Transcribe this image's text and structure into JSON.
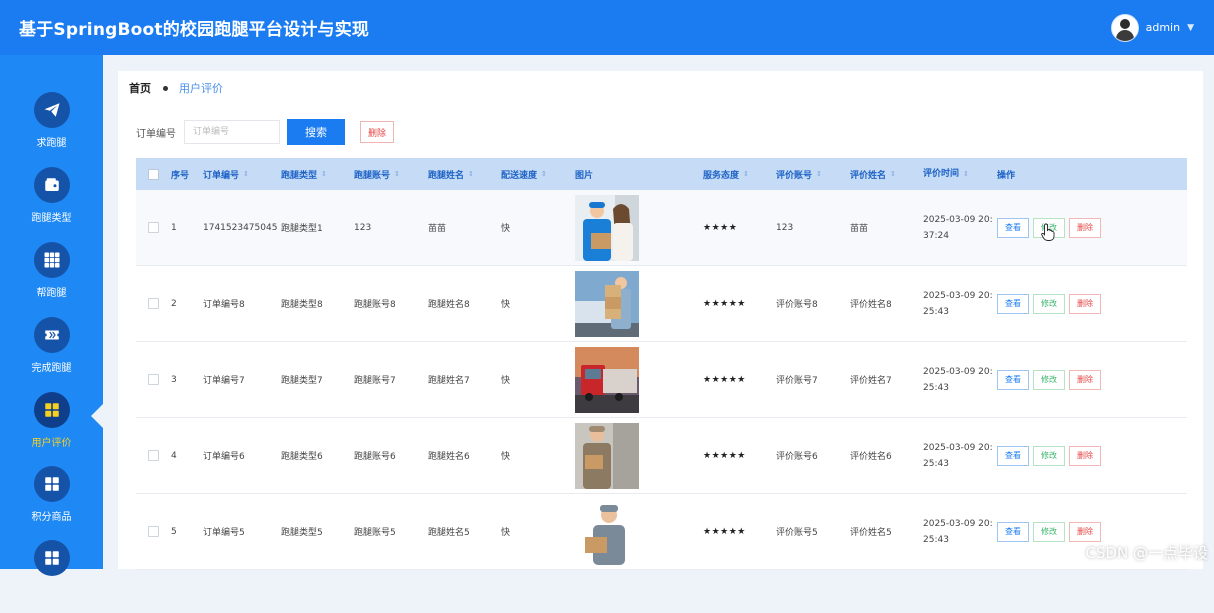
{
  "header": {
    "title": "基于SpringBoot的校园跑腿平台设计与实现",
    "username": "admin"
  },
  "sidebar": {
    "items": [
      {
        "label": "求跑腿",
        "icon": "paper-plane-icon"
      },
      {
        "label": "跑腿类型",
        "icon": "wallet-icon"
      },
      {
        "label": "帮跑腿",
        "icon": "grid-icon"
      },
      {
        "label": "完成跑腿",
        "icon": "ticket-icon"
      },
      {
        "label": "用户评价",
        "icon": "apps-icon",
        "active": true
      },
      {
        "label": "积分商品",
        "icon": "apps-icon"
      },
      {
        "label": "",
        "icon": "grid-icon"
      }
    ]
  },
  "breadcrumb": {
    "home": "首页",
    "current": "用户评价"
  },
  "search": {
    "label": "订单编号",
    "placeholder": "订单编号",
    "value": "",
    "search_button": "搜索",
    "delete_button": "删除"
  },
  "table": {
    "headers": [
      "序号",
      "订单编号",
      "跑腿类型",
      "跑腿账号",
      "跑腿姓名",
      "配送速度",
      "图片",
      "服务态度",
      "评价账号",
      "评价姓名",
      "评价时间",
      "操作"
    ],
    "rows": [
      {
        "idx": "1",
        "order": "1741523475045",
        "type": "跑腿类型1",
        "acct": "123",
        "name": "苗苗",
        "speed": "快",
        "attitude": "★★★★",
        "racct": "123",
        "rname": "苗苗",
        "time1": "2025-03-09 20:",
        "time2": "37:24",
        "photo": "delivery-man-with-customer"
      },
      {
        "idx": "2",
        "order": "订单编号8",
        "type": "跑腿类型8",
        "acct": "跑腿账号8",
        "name": "跑腿姓名8",
        "speed": "快",
        "attitude": "★★★★★",
        "racct": "评价账号8",
        "rname": "评价姓名8",
        "time1": "2025-03-09 20:",
        "time2": "25:43",
        "photo": "courier-with-boxes-trucks"
      },
      {
        "idx": "3",
        "order": "订单编号7",
        "type": "跑腿类型7",
        "acct": "跑腿账号7",
        "name": "跑腿姓名7",
        "speed": "快",
        "attitude": "★★★★★",
        "racct": "评价账号7",
        "rname": "评价姓名7",
        "time1": "2025-03-09 20:",
        "time2": "25:43",
        "photo": "red-truck-sunset"
      },
      {
        "idx": "4",
        "order": "订单编号6",
        "type": "跑腿类型6",
        "acct": "跑腿账号6",
        "name": "跑腿姓名6",
        "speed": "快",
        "attitude": "★★★★★",
        "racct": "评价账号6",
        "rname": "评价姓名6",
        "time1": "2025-03-09 20:",
        "time2": "25:43",
        "photo": "delivery-man-street"
      },
      {
        "idx": "5",
        "order": "订单编号5",
        "type": "跑腿类型5",
        "acct": "跑腿账号5",
        "name": "跑腿姓名5",
        "speed": "快",
        "attitude": "★★★★★",
        "racct": "评价账号5",
        "rname": "评价姓名5",
        "time1": "2025-03-09 20:",
        "time2": "25:43",
        "photo": "courier-holding-package"
      }
    ],
    "actions": {
      "view": "查看",
      "edit": "修改",
      "delete": "删除"
    }
  },
  "watermark": "CSDN @一点毕设",
  "colors": {
    "primary": "#1b7cf2",
    "sidebar": "#1e88f5",
    "icon_circle": "#1553a8",
    "header_row": "#c6dcf6",
    "danger": "#e64545",
    "success": "#3bb36a"
  }
}
